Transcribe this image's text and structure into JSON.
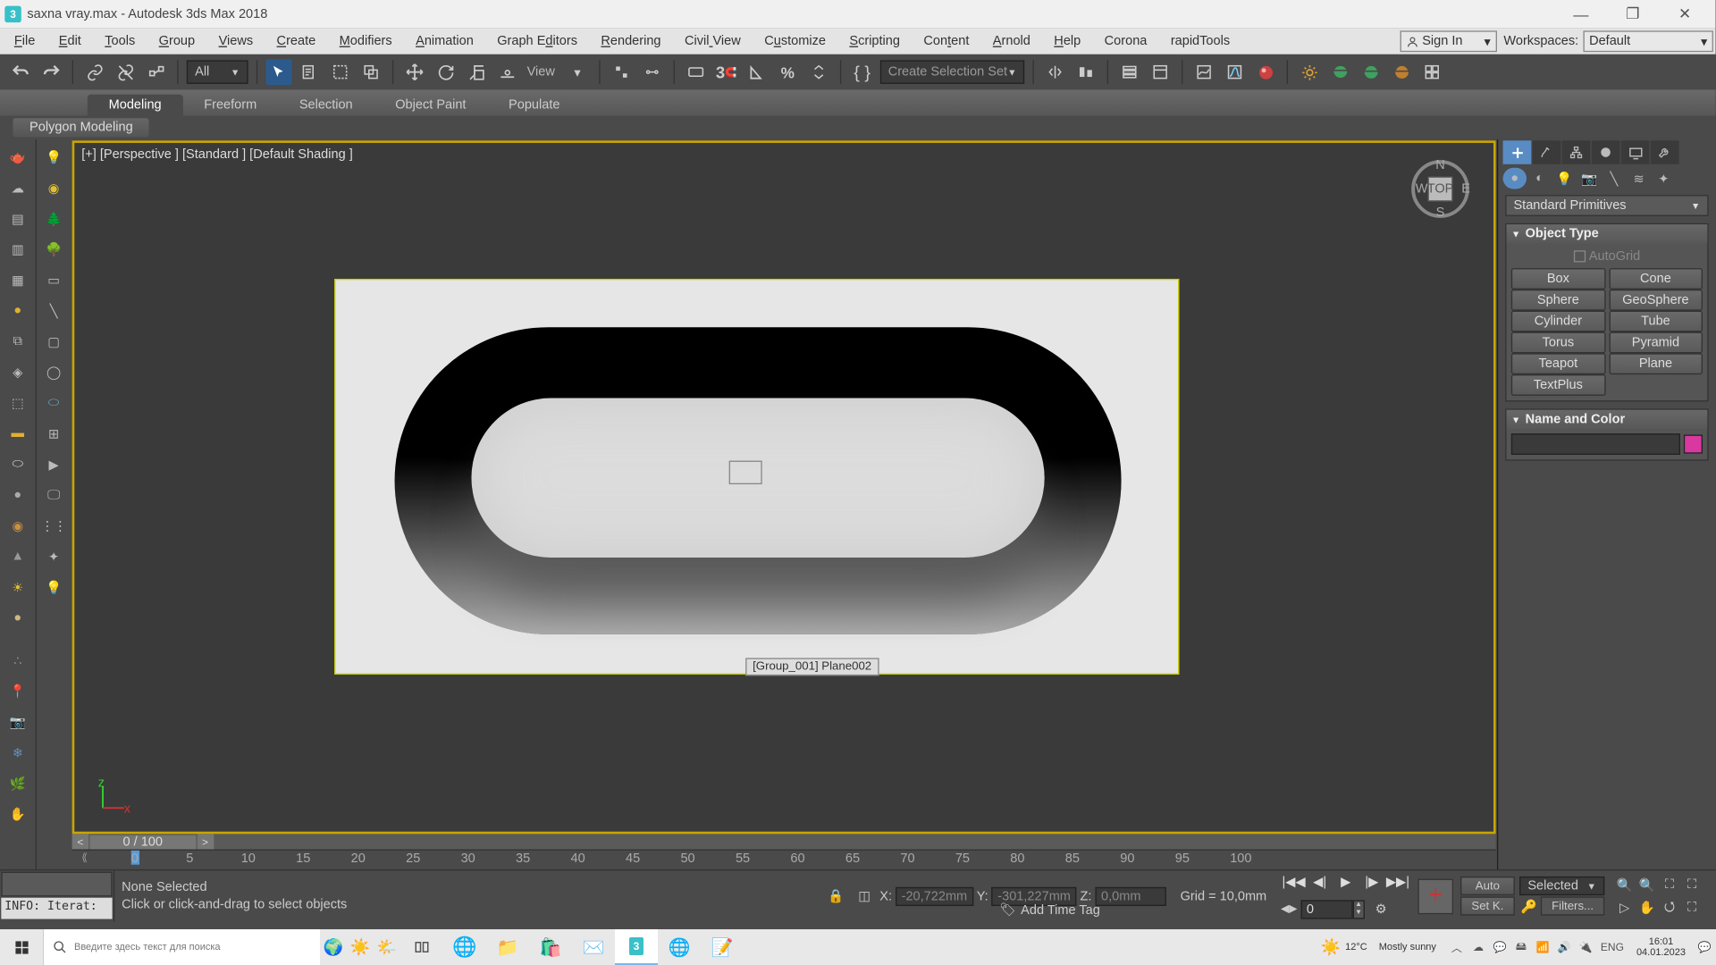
{
  "title": "saxna vray.max - Autodesk 3ds Max 2018",
  "menu": [
    "File",
    "Edit",
    "Tools",
    "Group",
    "Views",
    "Create",
    "Modifiers",
    "Animation",
    "Graph Editors",
    "Rendering",
    "Civil View",
    "Customize",
    "Scripting",
    "Content",
    "Arnold",
    "Help",
    "Corona",
    "rapidTools"
  ],
  "menu_u": [
    0,
    0,
    0,
    0,
    0,
    0,
    0,
    0,
    7,
    0,
    5,
    1,
    0,
    3,
    0,
    0,
    null,
    null
  ],
  "signin": "Sign In",
  "ws_label": "Workspaces:",
  "ws_value": "Default",
  "filter_all": "All",
  "view_label": "View",
  "selset": "Create Selection Set",
  "ribbon_tabs": [
    "Modeling",
    "Freeform",
    "Selection",
    "Object Paint",
    "Populate"
  ],
  "ribbon_sub": "Polygon Modeling",
  "vp_label": "[+] [Perspective ] [Standard ] [Default Shading ]",
  "obj_label": "[Group_001] Plane002",
  "timeslider": "0 / 100",
  "rp_dd": "Standard Primitives",
  "roll1": "Object Type",
  "autogrid": "AutoGrid",
  "prims": [
    [
      "Box",
      "Cone"
    ],
    [
      "Sphere",
      "GeoSphere"
    ],
    [
      "Cylinder",
      "Tube"
    ],
    [
      "Torus",
      "Pyramid"
    ],
    [
      "Teapot",
      "Plane"
    ],
    [
      "TextPlus",
      ""
    ]
  ],
  "roll2": "Name and Color",
  "status_info": "INFO: Iterat:",
  "status_sel": "None Selected",
  "status_hint": "Click or click-and-drag to select objects",
  "coord": {
    "x_lbl": "X:",
    "x": "-20,722mm",
    "y_lbl": "Y:",
    "y": "-301,227mm",
    "z_lbl": "Z:",
    "z": "0,0mm"
  },
  "grid": "Grid = 10,0mm",
  "addtag": "Add Time Tag",
  "auto": "Auto",
  "setk": "Set K.",
  "selected": "Selected",
  "filters": "Filters...",
  "frame0": "0",
  "ticks": [
    0,
    5,
    10,
    15,
    20,
    25,
    30,
    35,
    40,
    45,
    50,
    55,
    60,
    65,
    70,
    75,
    80,
    85,
    90,
    95,
    100
  ],
  "weather": {
    "temp": "12°C",
    "cond": "Mostly sunny"
  },
  "lang": "ENG",
  "time": "16:01",
  "date": "04.01.2023",
  "search_ph": "Введите здесь текст для поиска"
}
